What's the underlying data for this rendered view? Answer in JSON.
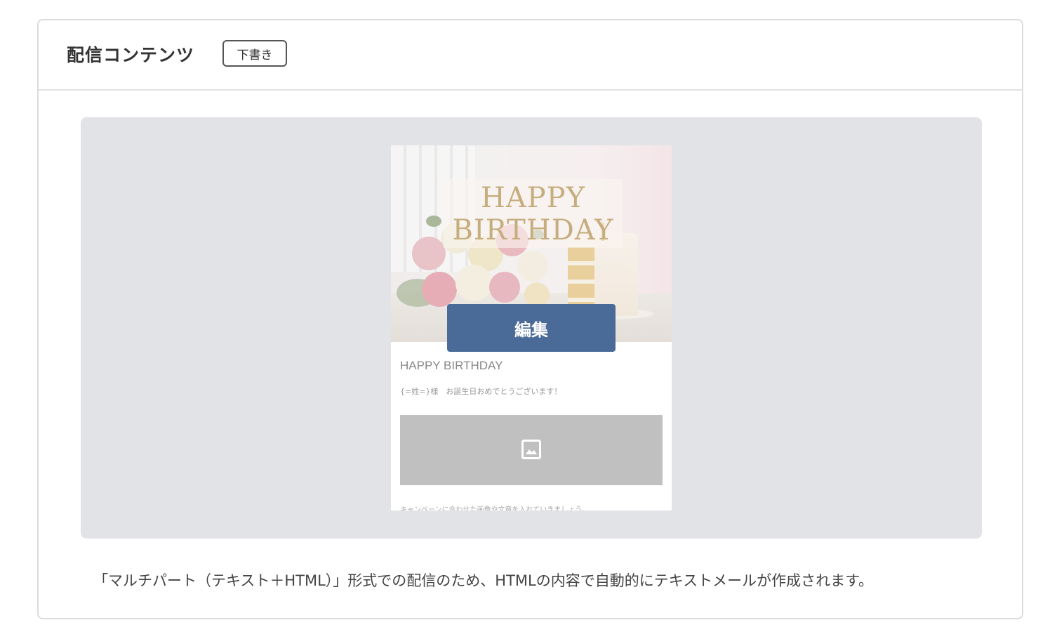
{
  "header": {
    "title": "配信コンテンツ",
    "status_badge": "下書き"
  },
  "preview": {
    "hero_title": "HAPPY BIRTHDAY",
    "edit_button_label": "編集",
    "email_heading": "HAPPY BIRTHDAY",
    "greeting_text": "{=姓=}様　お誕生日おめでとうございます！",
    "image_icon": "image-icon",
    "body_text": "キャンペーンに合わせた画像や文章を入れていきましょう。"
  },
  "footer": {
    "note": "「マルチパート（テキスト＋HTML）」形式での配信のため、HTMLの内容で自動的にテキストメールが作成されます。"
  },
  "colors": {
    "edit_button": "#4a6b98",
    "preview_background": "#e2e3e7",
    "hero_title": "#c6ad7e"
  }
}
